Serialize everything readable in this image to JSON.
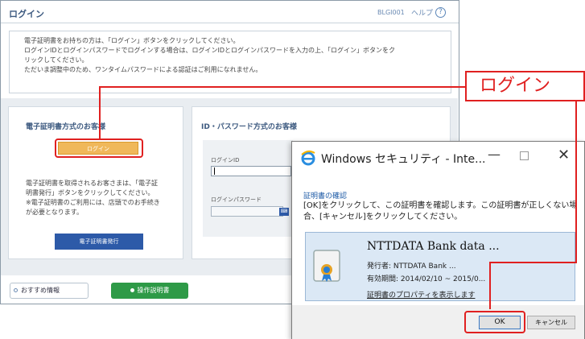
{
  "page": {
    "title": "ログイン",
    "code": "BLGI001",
    "help_label": "ヘルプ",
    "help_icon": "?",
    "intro_lines": [
      "電子証明書をお持ちの方は、「ログイン」ボタンをクリックしてください。",
      "ログインIDとログインパスワードでログインする場合は、ログインIDとログインパスワードを入力の上、「ログイン」ボタンをク",
      "リックしてください。",
      "ただいま調整中のため、ワンタイムパスワードによる認証はご利用になれません。"
    ],
    "cert_panel": {
      "heading": "電子証明書方式のお客様",
      "login_button": "ログイン",
      "desc_lines": [
        "電子証明書を取得されるお客さまは、「電子証",
        "明書発行」ボタンをクリックしてください。",
        "※電子証明書のご利用には、店頭でのお手続き",
        "が必要となります。"
      ],
      "issue_button": "電子証明書発行"
    },
    "id_panel": {
      "heading": "ID・パスワード方式のお客様",
      "id_label": "ログインID",
      "pw_label": "ログインパスワード",
      "keyboard_icon": "⌨"
    },
    "footer": {
      "recommend_label": "おすすめ情報",
      "manual_label": "操作説明書"
    }
  },
  "callout": {
    "label": "ログイン"
  },
  "dialog": {
    "title": "Windows セキュリティ - Inte...",
    "minimize": "—",
    "close": "✕",
    "heading": "証明書の確認",
    "message": "[OK]をクリックして、この証明書を確認します。この証明書が正しくない場合、[キャンセル]をクリックしてください。",
    "cert": {
      "name": "NTTDATA Bank data ...",
      "issuer": "発行者:  NTTDATA Bank ...",
      "validity": "有効期間:  2014/02/10 ~ 2015/0...",
      "props_link": "証明書のプロパティを表示します"
    },
    "ok_label": "OK",
    "cancel_label": "キャンセル"
  },
  "colors": {
    "highlight": "#e02020",
    "login_orange": "#f0b85a",
    "primary_blue": "#2d5aa8",
    "manual_green": "#2e9a47"
  }
}
